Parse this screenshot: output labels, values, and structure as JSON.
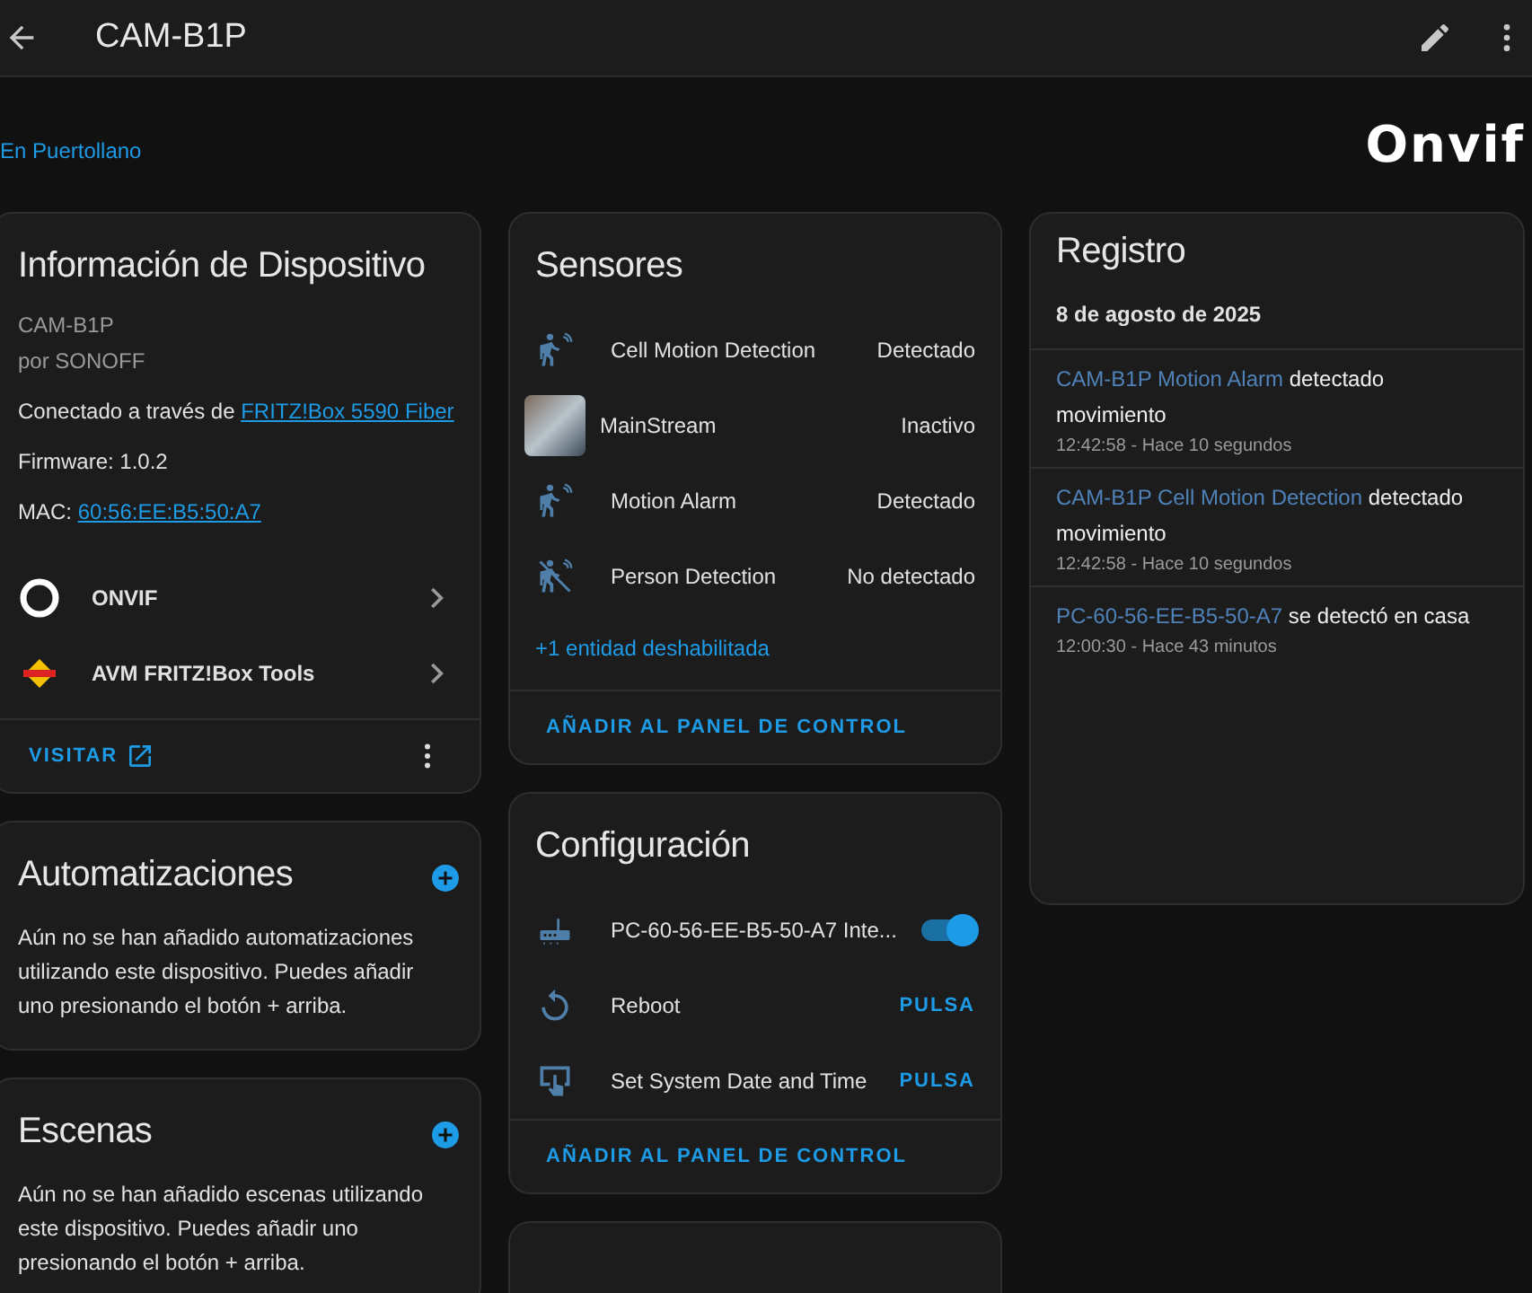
{
  "top_bar": {
    "title": "CAM-B1P"
  },
  "area_link": "En Puertollano",
  "logo": "Onvif",
  "device_info": {
    "title": "Información de Dispositivo",
    "model": "CAM-B1P",
    "manufacturer": "por SONOFF",
    "connected_prefix": "Conectado a través de ",
    "connected_link": "FRITZ!Box 5590 Fiber",
    "firmware": "Firmware: 1.0.2",
    "mac_prefix": "MAC: ",
    "mac_link": "60:56:EE:B5:50:A7",
    "integrations": [
      {
        "kind": "ring",
        "name": "ONVIF"
      },
      {
        "kind": "fritz",
        "name": "AVM FRITZ!Box Tools"
      }
    ],
    "visit_button": "VISITAR"
  },
  "automations": {
    "title": "Automatizaciones",
    "text": "Aún no se han añadido automatizaciones utilizando este dispositivo. Puedes añadir uno presionando el botón + arriba."
  },
  "scenes": {
    "title": "Escenas",
    "text": "Aún no se han añadido escenas utilizando este dispositivo. Puedes añadir uno presionando el botón + arriba."
  },
  "sensors": {
    "title": "Sensores",
    "items": [
      {
        "kind": "motion",
        "name": "Cell Motion Detection",
        "state": "Detectado"
      },
      {
        "kind": "image",
        "name": "MainStream",
        "state": "Inactivo"
      },
      {
        "kind": "motion",
        "name": "Motion Alarm",
        "state": "Detectado"
      },
      {
        "kind": "motion-off",
        "name": "Person Detection",
        "state": "No detectado"
      }
    ],
    "disabled_link": "+1 entidad deshabilitada",
    "add_button": "AÑADIR AL PANEL DE CONTROL"
  },
  "configuration": {
    "title": "Configuración",
    "items": [
      {
        "kind": "switch",
        "name": "PC-60-56-EE-B5-50-A7 Inte...",
        "on": true
      },
      {
        "kind": "press",
        "name": "Reboot",
        "action": "PULSA"
      },
      {
        "kind": "press",
        "name": "Set System Date and Time",
        "action": "PULSA"
      }
    ],
    "add_button": "AÑADIR AL PANEL DE CONTROL"
  },
  "logbook": {
    "title": "Registro",
    "date": "8 de agosto de 2025",
    "entries": [
      {
        "entity": "CAM-B1P Motion Alarm",
        "message": "detectado movimiento",
        "time": "12:42:58 - Hace 10 segundos"
      },
      {
        "entity": "CAM-B1P Cell Motion Detection",
        "message": "detectado movimiento",
        "time": "12:42:58 - Hace 10 segundos"
      },
      {
        "entity": "PC-60-56-EE-B5-50-A7",
        "message": "se detectó en casa",
        "time": "12:00:30 - Hace 43 minutos"
      }
    ]
  }
}
